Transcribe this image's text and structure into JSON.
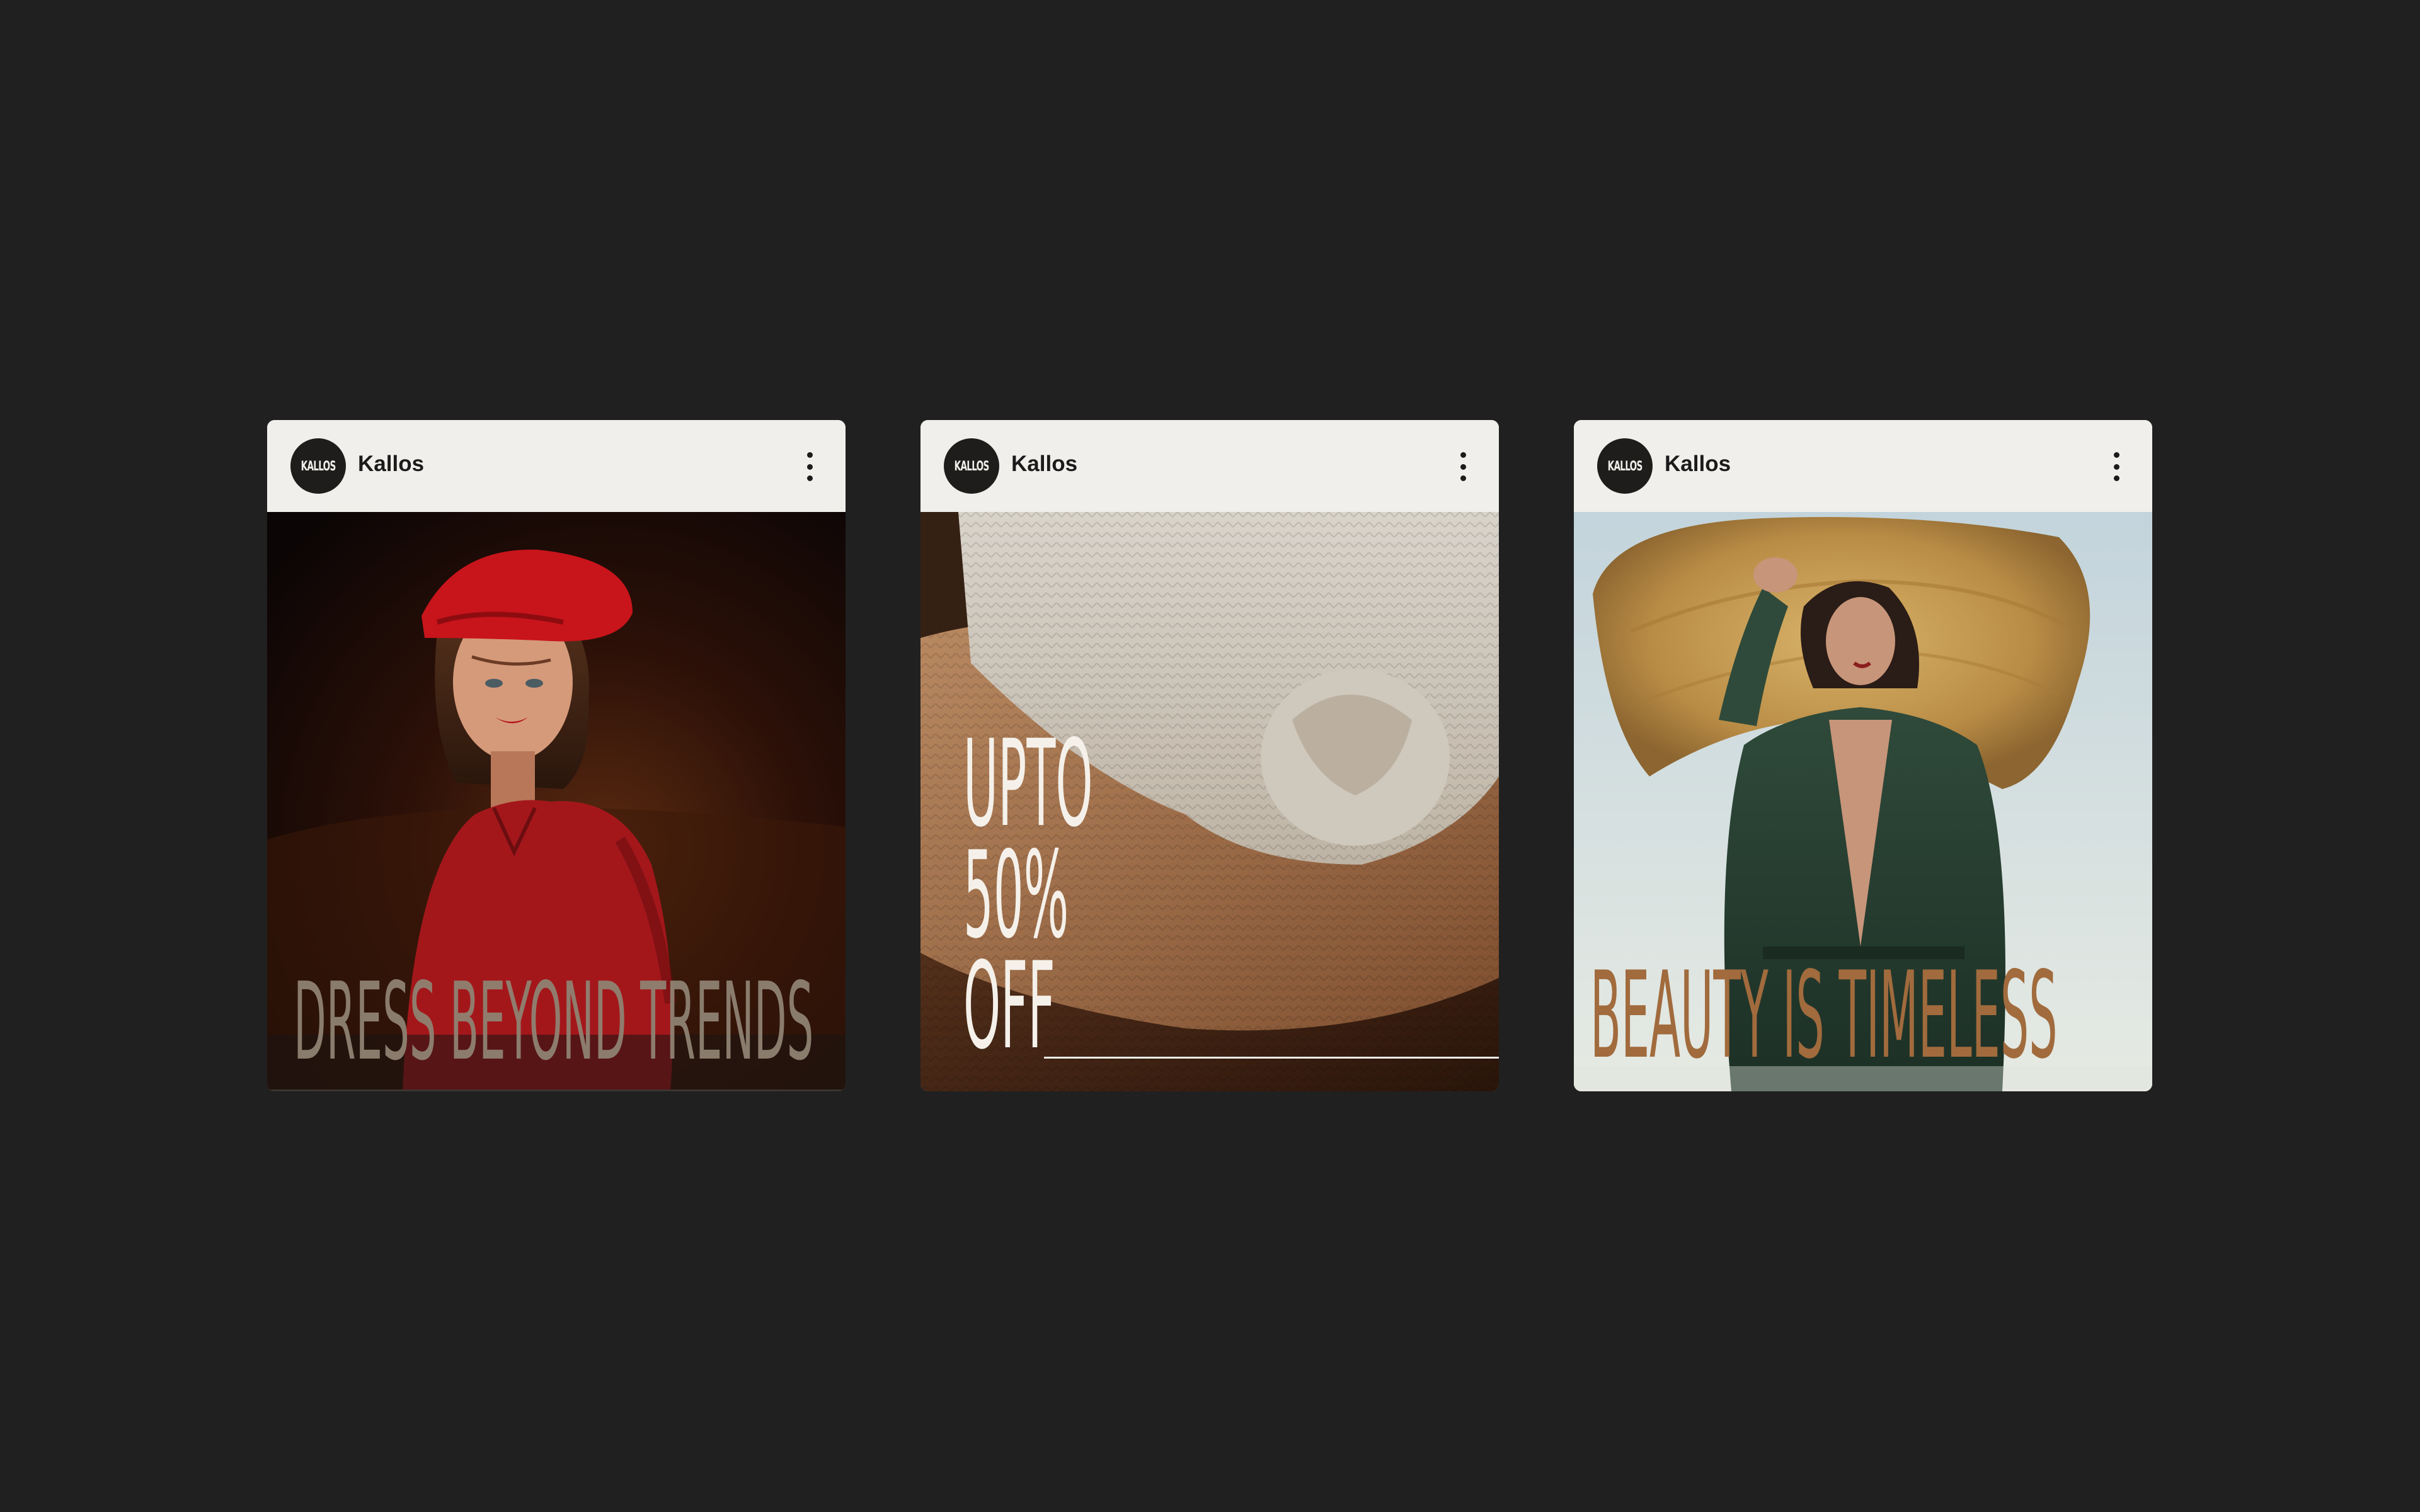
{
  "colors": {
    "page_background": "#202020",
    "card_header": "#f1efeb",
    "avatar": "#1e1d1c",
    "headline_1": "#8f8272",
    "headline_2": "#f5f1ea",
    "headline_3": "#a16b3d"
  },
  "posts": [
    {
      "account_name": "Kallos",
      "avatar_text": "KALLOS",
      "menu_icon": "more-vertical-icon",
      "headline": "DRESS BEYOND TRENDS"
    },
    {
      "account_name": "Kallos",
      "avatar_text": "KALLOS",
      "menu_icon": "more-vertical-icon",
      "headline_lines": [
        "UPTO",
        "50%",
        "OFF"
      ]
    },
    {
      "account_name": "Kallos",
      "avatar_text": "KALLOS",
      "menu_icon": "more-vertical-icon",
      "headline": "BEAUTY IS TIMELESS"
    }
  ]
}
